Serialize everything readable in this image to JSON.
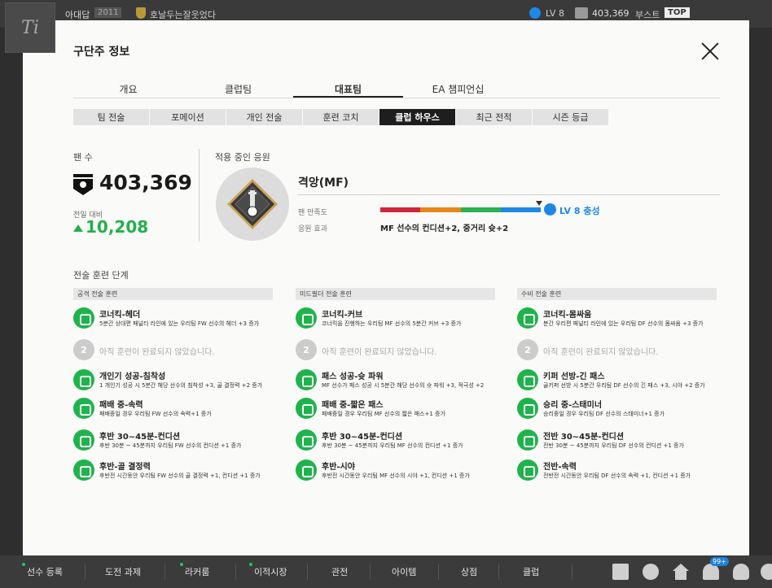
{
  "topbar": {
    "logo_text": "Ti",
    "manager_name": "아대답",
    "year": "2011",
    "club_name": "호날두는잘웃었다",
    "level": "LV 8",
    "fans": "403,369",
    "boost": "부스트",
    "top": "TOP"
  },
  "modal": {
    "title": "구단주 정보",
    "main_tabs": [
      "개요",
      "클럽팀",
      "대표팀",
      "EA 챔피언십"
    ],
    "sub_tabs": [
      "팀 전술",
      "포메이션",
      "개인 전술",
      "훈련 코치",
      "클럽 하우스",
      "최근 전적",
      "시즌 등급"
    ]
  },
  "fans": {
    "label": "팬 수",
    "count": "403,369",
    "delta_label": "전일 대비",
    "delta_value": "10,208"
  },
  "support": {
    "label": "적용 중인 응원",
    "name": "격앙(MF)",
    "satisfaction_label": "팬 만족도",
    "satisfaction_colors": [
      "#d0253b",
      "#e8861a",
      "#2bb24c",
      "#1e88e5"
    ],
    "level_text": "LV 8 충성",
    "effect_label": "응원 효과",
    "effect_text": "MF 선수의 컨디션+2, 중거리 슛+2"
  },
  "training": {
    "title": "전술 훈련 단계",
    "locked_text": "아직 훈련이 완료되지 않았습니다.",
    "locked_number": "2",
    "columns": [
      {
        "header": "공격 전술 훈련",
        "items": [
          {
            "name": "코너킥-헤더",
            "desc": "5분간 상대편 패널티 라인에 있는 우리팀 FW 선수의 헤더 +3 증가"
          },
          {
            "name": "개인기 성공-침착성",
            "desc": "1 개인기 성공 시 5분간 해당 선수의 침착성 +3, 골 결정력 +2 증가"
          },
          {
            "name": "패배 중-속력",
            "desc": "패배중일 경우 우리팀 FW 선수의 속력+1 증가"
          },
          {
            "name": "후반 30~45분-컨디션",
            "desc": "후반 30분 ~ 45분까지 우리팀 FW 선수의 컨디션 +1 증가"
          },
          {
            "name": "후반-골 결정력",
            "desc": "후반전 시간동안 우리팀 FW 선수의 골 결정력 +1, 컨디션 +1 증가"
          }
        ]
      },
      {
        "header": "미드필더 전술 훈련",
        "items": [
          {
            "name": "코너킥-커브",
            "desc": "코너킥을 진행하는 우리팀 MF 선수의 5분간 커브 +3 증가"
          },
          {
            "name": "패스 성공-슛 파워",
            "desc": "MF 선수가 패스 성공 시 5분간 해당 선수의 슛 파워 +3, 적극성 +2"
          },
          {
            "name": "패배 중-짧은 패스",
            "desc": "패배중일 경우 우리팀 MF 선수의 짧은 패스+1 증가"
          },
          {
            "name": "후반 30~45분-컨디션",
            "desc": "후반 30분 ~ 45분까지 우리팀 MF 선수의 컨디션 +1 증가"
          },
          {
            "name": "후반-시야",
            "desc": "후반전 시간동안 우리팀 MF 선수의 시야 +1, 컨디션 +1 증가"
          }
        ]
      },
      {
        "header": "수비 전술 훈련",
        "items": [
          {
            "name": "코너킥-몸싸움",
            "desc": "분간 우리편 패널티 라인에 있는 우리팀 DF 선수의 몸싸움 +3 증가"
          },
          {
            "name": "키퍼 선방-긴 패스",
            "desc": "골키퍼 선방 시 5분간 우리팀 DF 선수의 긴 패스 +3, 시야 +2 증가"
          },
          {
            "name": "승리 중-스태미너",
            "desc": "승리중일 경우 우리팀 DF 선수의 스태미너+1 증가"
          },
          {
            "name": "전반 30~45분-컨디션",
            "desc": "전반 30분 ~ 45분까지 우리팀 DF 선수의 컨디션 +1 증가"
          },
          {
            "name": "전반-속력",
            "desc": "전반전 시간동안 우리팀 DF 선수의 속력 +1, 컨디션 +1 증가"
          }
        ]
      }
    ]
  },
  "bottombar": {
    "items": [
      "선수 등록",
      "도전 과제",
      "라커룸",
      "이적시장",
      "관전",
      "아이템",
      "상점",
      "클럽"
    ],
    "badge": "99+"
  }
}
